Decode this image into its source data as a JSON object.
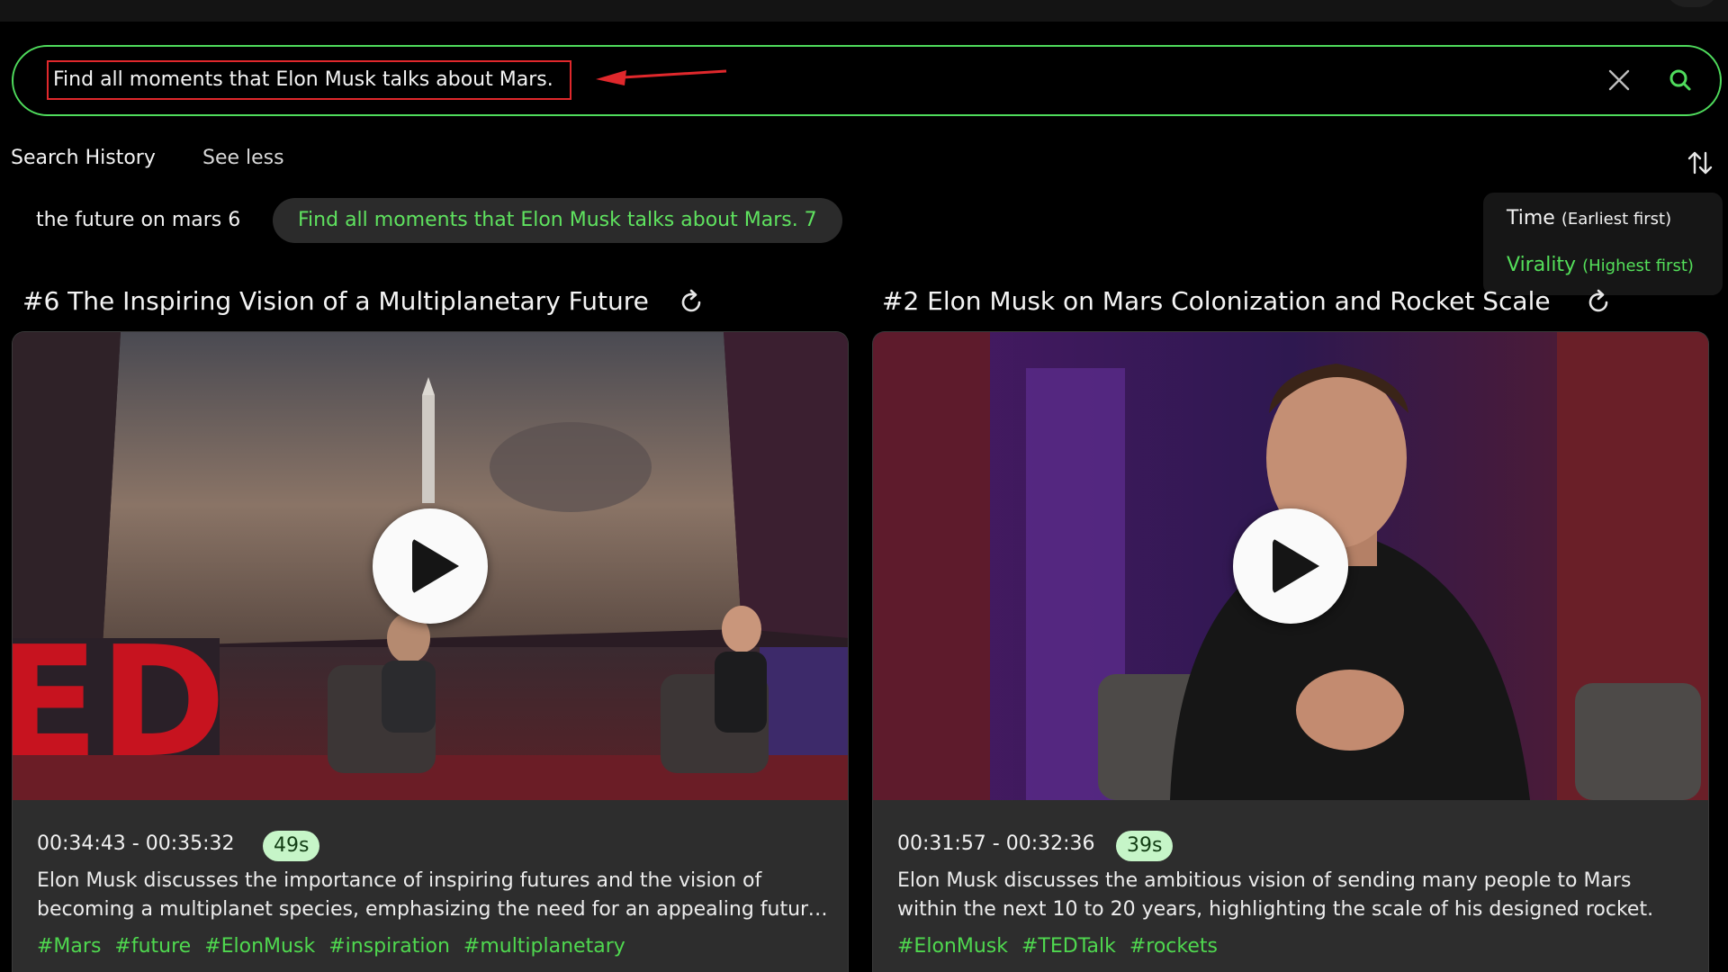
{
  "search": {
    "query": "Find all moments that Elon Musk talks about Mars."
  },
  "icons": {
    "clear": "close-icon",
    "search": "search-icon",
    "sort": "sort-arrows-icon",
    "refresh": "refresh-icon",
    "play": "play-icon"
  },
  "history": {
    "title": "Search History",
    "toggle_label": "See less",
    "items": [
      {
        "label": "the future on mars 6",
        "active": false
      },
      {
        "label": "Find all moments that Elon Musk talks about Mars. 7",
        "active": true
      }
    ]
  },
  "sort_menu": {
    "options": [
      {
        "label": "Time",
        "sub": "(Earliest first)",
        "selected": false
      },
      {
        "label": "Virality",
        "sub": "(Highest first)",
        "selected": true
      }
    ]
  },
  "results": [
    {
      "title": "#6 The Inspiring Vision of a Multiplanetary Future",
      "timecode": "00:34:43 - 00:35:32",
      "duration": "49s",
      "description": "Elon Musk discusses the importance of inspiring futures and the vision of becoming a multiplanet species, emphasizing the need for an appealing future that excites people about life.",
      "tags": [
        "#Mars",
        "#future",
        "#ElonMusk",
        "#inspiration",
        "#multiplanetary"
      ]
    },
    {
      "title": "#2 Elon Musk on Mars Colonization and Rocket Scale",
      "timecode": "00:31:57 - 00:32:36",
      "duration": "39s",
      "description": "Elon Musk discusses the ambitious vision of sending many people to Mars within the next 10 to 20 years, highlighting the scale of his designed rocket.",
      "tags": [
        "#ElonMusk",
        "#TEDTalk",
        "#rockets"
      ]
    }
  ],
  "colors": {
    "accent_green": "#4fdb5c",
    "annotation_red": "#e0282c",
    "background": "#000000",
    "card": "#2d2d2d"
  }
}
